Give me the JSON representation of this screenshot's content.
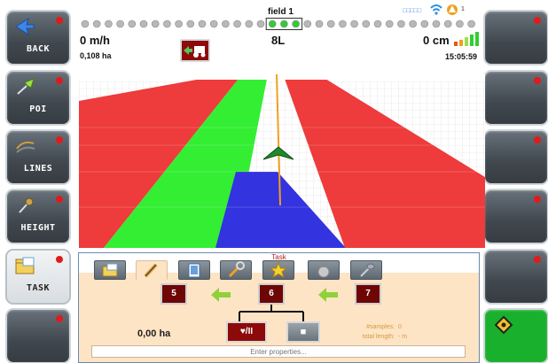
{
  "left_buttons": [
    {
      "label": "BACK",
      "icon": "back-arrow-icon"
    },
    {
      "label": "POI",
      "icon": "poi-pin-icon"
    },
    {
      "label": "LINES",
      "icon": "lines-icon"
    },
    {
      "label": "HEIGHT",
      "icon": "height-icon"
    },
    {
      "label": "TASK",
      "icon": "task-folder-icon"
    },
    {
      "label": "",
      "icon": ""
    }
  ],
  "right_buttons": [
    {
      "label": ""
    },
    {
      "label": ""
    },
    {
      "label": ""
    },
    {
      "label": ""
    },
    {
      "label": ""
    },
    {
      "label": "",
      "icon": "diamond-icon"
    }
  ],
  "status": {
    "field_name": "field 1",
    "speed": "0 m/h",
    "area": "0,108 ha",
    "section_label": "8L",
    "offset": "0 cm",
    "time": "15:05:59",
    "gps_label": "□□□□□",
    "satellite_count": "1",
    "signal_bars_filled": 5,
    "colors": {
      "lightbar_active": "#33cc33",
      "lightbar_idle": "#b8b8b8",
      "signal": "#33cc33",
      "signal_low": "#e05a12"
    }
  },
  "view": {
    "colors": {
      "red": "#ee3b3b",
      "green": "#33ee33",
      "blue": "#3333e0",
      "guide_line": "#f0a020",
      "marker": "#1f8a2a"
    }
  },
  "task": {
    "title": "Task",
    "tabs": [
      "folder-icon",
      "pencil-icon",
      "notepad-icon",
      "wrench-icon",
      "star-icon",
      "garlic-icon",
      "shovel-icon"
    ],
    "active_tab_index": 1,
    "nodes": [
      "5",
      "6",
      "7"
    ],
    "area": "0,00 ha",
    "record_button": "♥/II",
    "stop_button": "■",
    "samples_label": "#samples:",
    "samples_value": "0",
    "length_label": "total length:",
    "length_value": "- m",
    "properties_placeholder": "Enter properties..."
  }
}
